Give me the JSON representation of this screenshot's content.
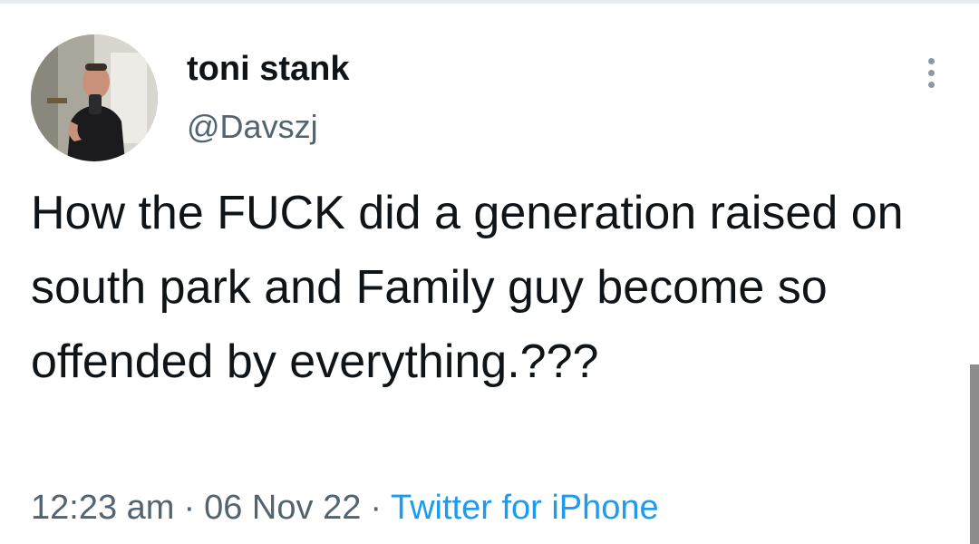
{
  "tweet": {
    "display_name": "toni stank",
    "handle": "@Davszj",
    "text": "How the FUCK did a generation raised on south park and Family guy become so offended by everything.???",
    "time": "12:23 am",
    "date": "06 Nov 22",
    "source": "Twitter for iPhone",
    "separator": "·",
    "avatar_icon": "profile-photo",
    "more_icon": "more-options-icon"
  },
  "colors": {
    "text": "#0f1419",
    "secondary": "#536471",
    "link": "#1d9bf0"
  }
}
